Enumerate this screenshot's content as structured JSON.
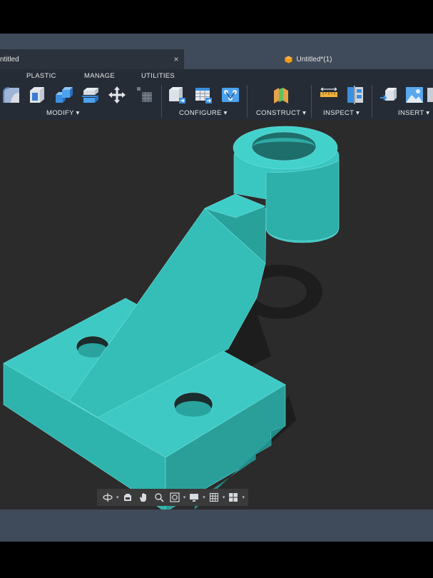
{
  "tabs": [
    {
      "label": "ntitled",
      "close": "×"
    },
    {
      "label": "Untitled*(1)"
    }
  ],
  "toolbar": {
    "categories": [
      "PLASTIC",
      "MANAGE",
      "UTILITIES"
    ],
    "groups": {
      "modify": "MODIFY ▾",
      "configure": "CONFIGURE ▾",
      "construct": "CONSTRUCT ▾",
      "inspect": "INSPECT ▾",
      "insert": "INSERT ▾"
    }
  },
  "model": {
    "name": "bracket-part",
    "color": "#38c2c0"
  },
  "colors": {
    "app_bg": "#2b2b2b",
    "toolbar_bg": "#252c36",
    "tabbar_bg": "#3f4a5a",
    "accent_doc": "#f39c12"
  },
  "navbar": {
    "icons": [
      "orbit-icon",
      "look-at-icon",
      "pan-icon",
      "zoom-icon",
      "fit-icon",
      "display-settings-icon",
      "grid-icon",
      "viewports-icon"
    ]
  }
}
